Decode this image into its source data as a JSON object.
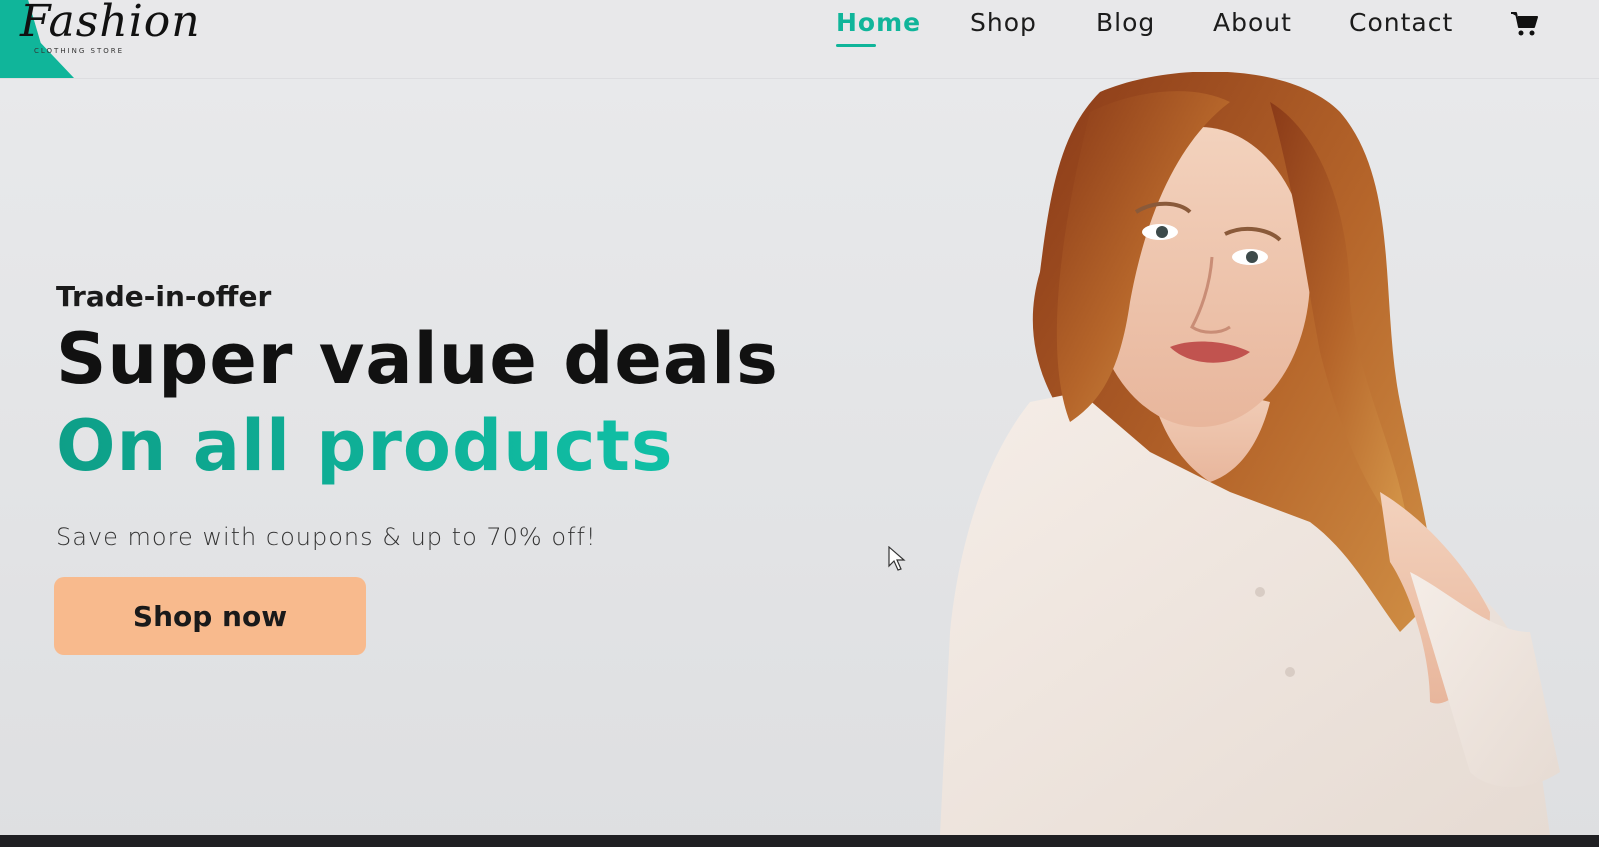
{
  "brand": {
    "name": "Fashion",
    "tagline": "CLOTHING STORE",
    "accent_color": "#10b59a"
  },
  "nav": {
    "items": [
      {
        "label": "Home",
        "active": true
      },
      {
        "label": "Shop",
        "active": false
      },
      {
        "label": "Blog",
        "active": false
      },
      {
        "label": "About",
        "active": false
      },
      {
        "label": "Contact",
        "active": false
      }
    ],
    "cart_icon": "shopping-cart-icon"
  },
  "hero": {
    "kicker": "Trade-in-offer",
    "headline": "Super value deals",
    "subheadline": "On all products",
    "tagline": "Save more with coupons & up to 70% off!",
    "cta_label": "Shop now",
    "cta_color": "#f8ba8d",
    "image_icon": "model-photo"
  }
}
